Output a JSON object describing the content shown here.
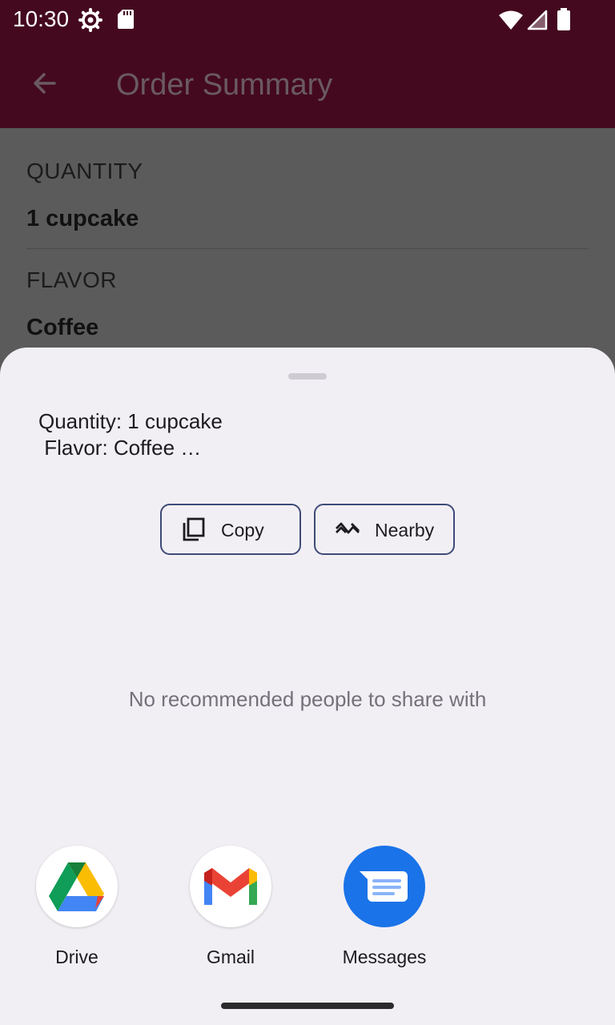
{
  "status_bar": {
    "time": "10:30",
    "icons": [
      "settings-gear-icon",
      "sd-card-icon",
      "wifi-icon",
      "cell-signal-icon",
      "battery-icon"
    ]
  },
  "app_bar": {
    "title": "Order Summary",
    "back_icon": "arrow-back-icon",
    "color": "#44091f"
  },
  "summary": {
    "quantity_label": "QUANTITY",
    "quantity_value": "1 cupcake",
    "flavor_label": "FLAVOR",
    "flavor_value": "Coffee"
  },
  "share_sheet": {
    "preview_text": "Quantity: 1 cupcake\n Flavor: Coffee …",
    "actions": [
      {
        "label": "Copy",
        "icon": "copy-icon"
      },
      {
        "label": "Nearby",
        "icon": "nearby-share-icon"
      }
    ],
    "empty_message": "No recommended people to share with",
    "targets": [
      {
        "label": "Drive",
        "icon": "google-drive-icon"
      },
      {
        "label": "Gmail",
        "icon": "gmail-icon"
      },
      {
        "label": "Messages",
        "icon": "messages-icon"
      }
    ],
    "colors": {
      "sheet_bg": "#f2eff4",
      "chip_border": "#3e4a78",
      "messages_blue": "#1a73e8"
    }
  }
}
